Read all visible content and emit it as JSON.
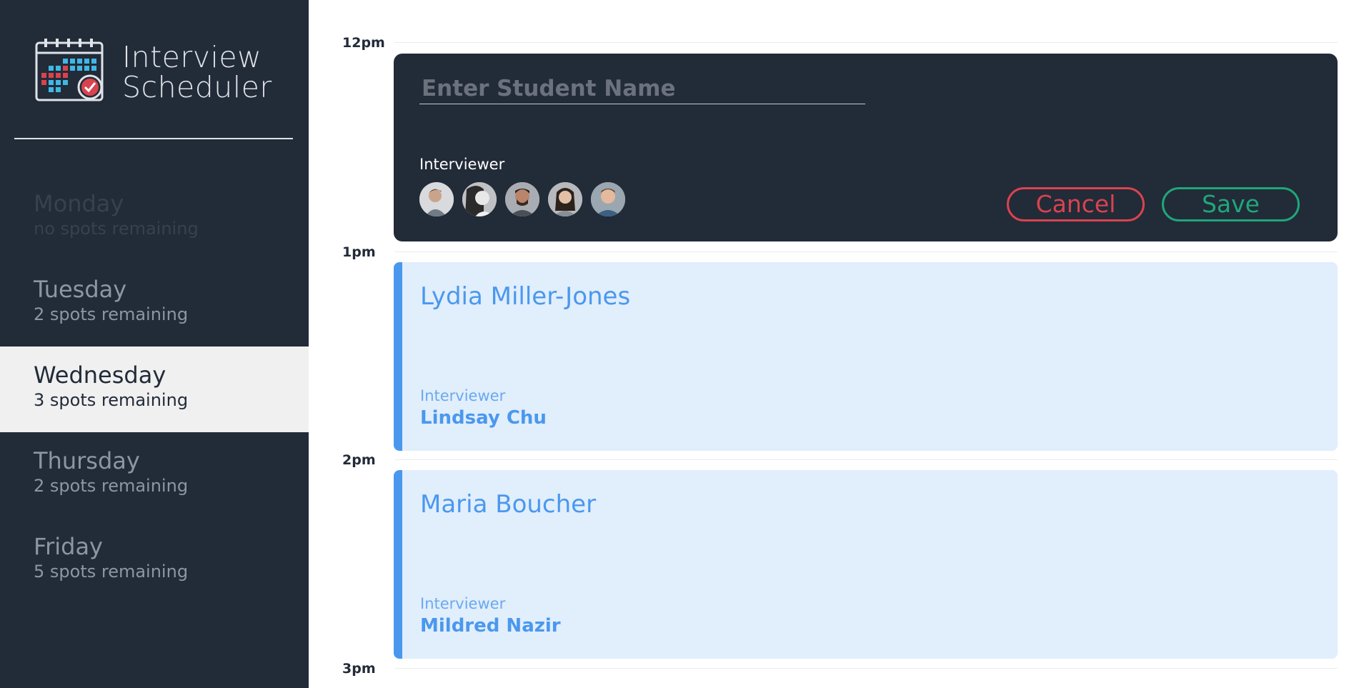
{
  "app": {
    "brand": {
      "line1": "Interview",
      "line2": "Scheduler",
      "icon": "calendar-check-icon"
    }
  },
  "sidebar": {
    "days": [
      {
        "name": "Monday",
        "spots": "no spots remaining",
        "state": "full"
      },
      {
        "name": "Tuesday",
        "spots": "2 spots remaining",
        "state": "normal"
      },
      {
        "name": "Wednesday",
        "spots": "3 spots remaining",
        "state": "selected"
      },
      {
        "name": "Thursday",
        "spots": "2 spots remaining",
        "state": "normal"
      },
      {
        "name": "Friday",
        "spots": "5 spots remaining",
        "state": "normal"
      }
    ]
  },
  "schedule": {
    "hours": [
      "12pm",
      "1pm",
      "2pm",
      "3pm"
    ],
    "form": {
      "student_placeholder": "Enter Student Name",
      "student_value": "",
      "interviewer_heading": "Interviewer",
      "avatars": [
        "interviewer-avatar-1",
        "interviewer-avatar-2",
        "interviewer-avatar-3",
        "interviewer-avatar-4",
        "interviewer-avatar-5"
      ],
      "cancel_label": "Cancel",
      "save_label": "Save"
    },
    "appointments": [
      {
        "student": "Lydia Miller-Jones",
        "interviewer_caption": "Interviewer",
        "interviewer": "Lindsay Chu"
      },
      {
        "student": "Maria Boucher",
        "interviewer_caption": "Interviewer",
        "interviewer": "Mildred Nazir"
      }
    ]
  },
  "colors": {
    "sidebar_bg": "#222b38",
    "selected_day_bg": "#f0f0f0",
    "appointment_bg": "#e1eefc",
    "appointment_accent": "#4a98ee",
    "cancel": "#d9434f",
    "save": "#1fa67a"
  }
}
